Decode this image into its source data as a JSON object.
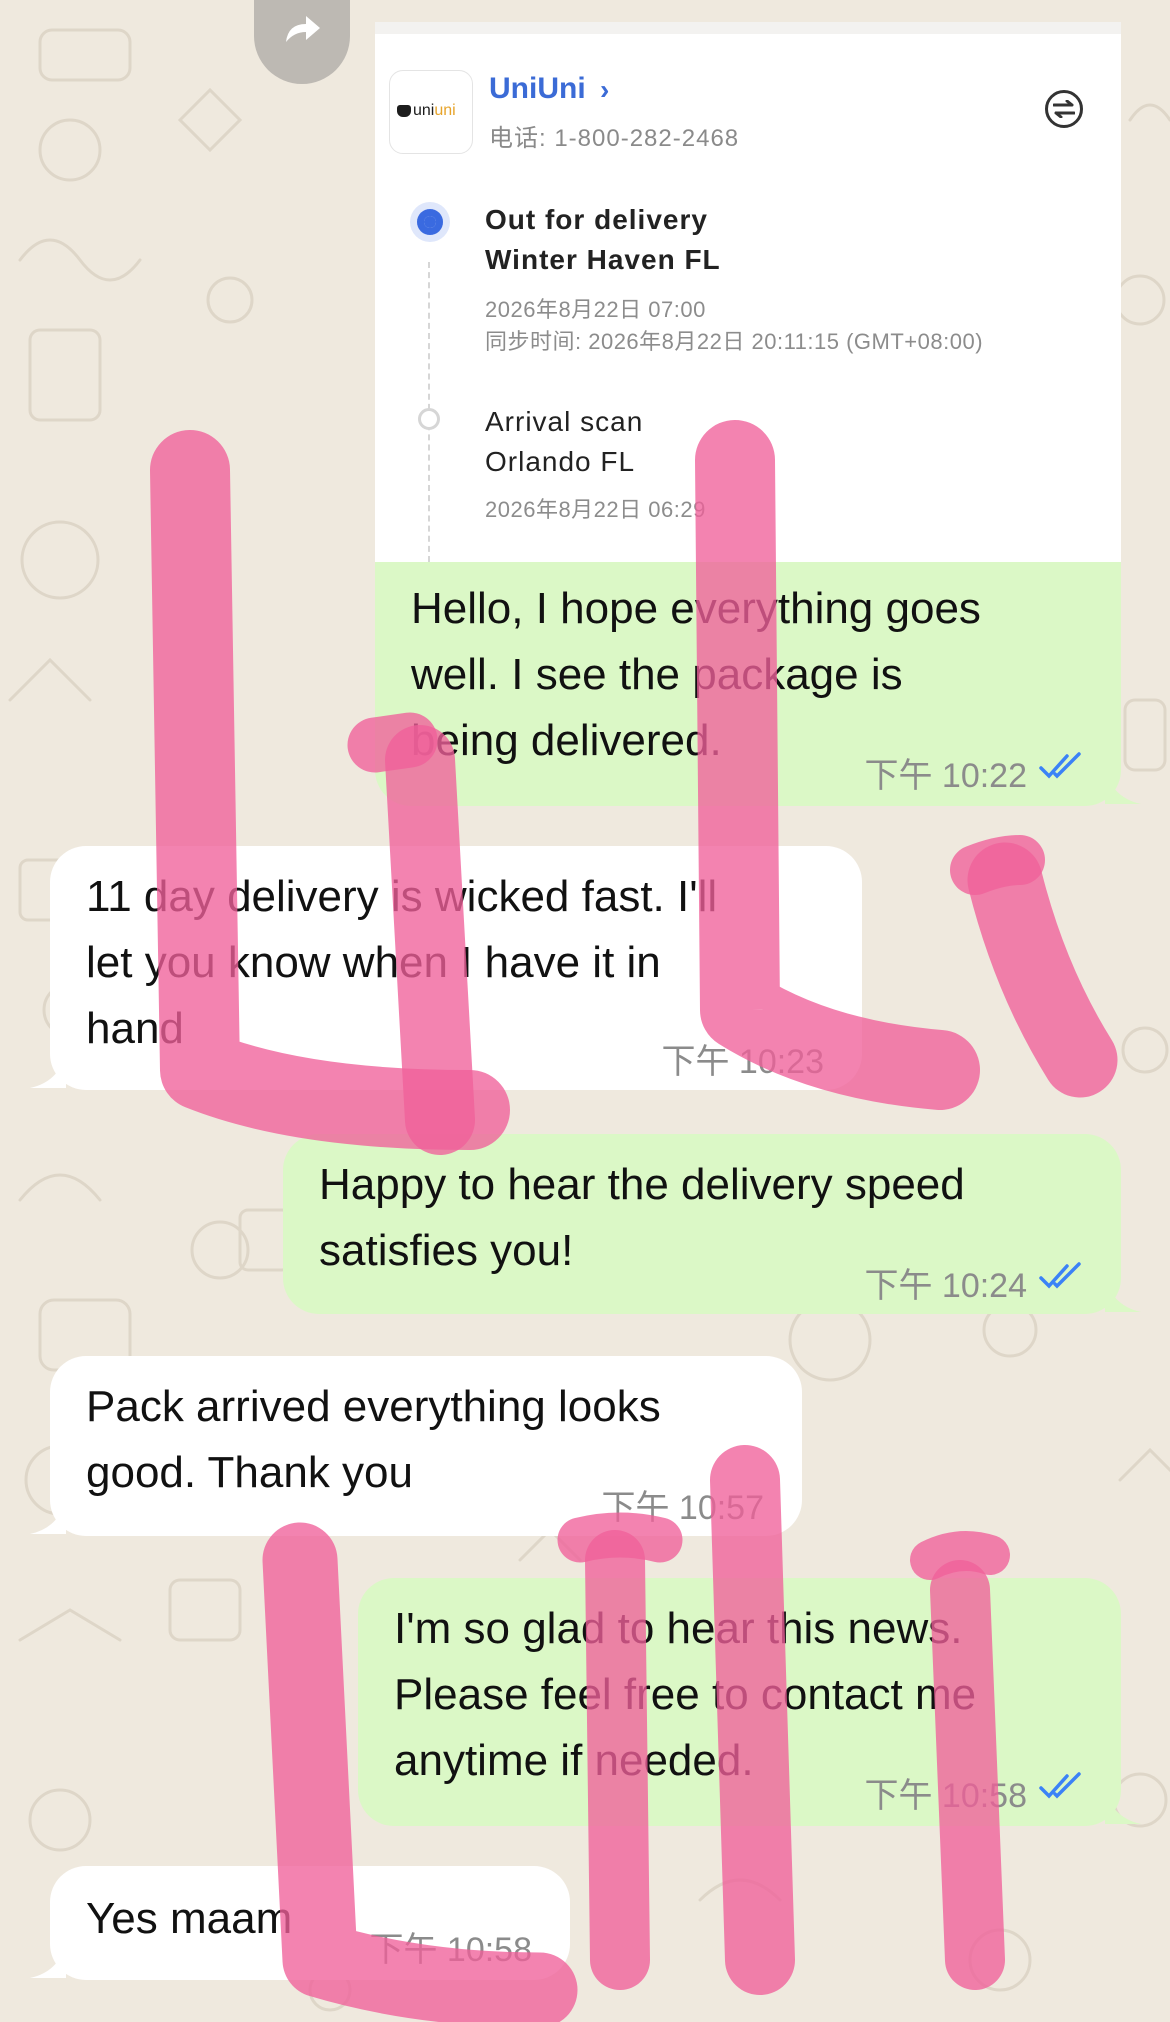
{
  "tracking_card": {
    "carrier_name": "UniUni",
    "carrier_chevron": "›",
    "logo_text_a": "uni",
    "logo_text_b": "uni",
    "phone": "电话: 1-800-282-2468",
    "swap_icon": "swap-arrows-icon",
    "events": [
      {
        "status": "Out for delivery",
        "location": "Winter Haven FL",
        "time": "2026年8月22日 07:00",
        "sync": "同步时间: 2026年8月22日 20:11:15 (GMT+08:00)",
        "active": true
      },
      {
        "status": "Arrival scan",
        "location": "Orlando FL",
        "time": "2026年8月22日 06:29",
        "active": false
      }
    ]
  },
  "messages": [
    {
      "dir": "out",
      "lines": [
        "Hello, I hope everything goes",
        "well. I see the package is",
        "being delivered."
      ],
      "time": "下午 10:22",
      "read": true
    },
    {
      "dir": "in",
      "lines": [
        "11 day delivery is wicked fast. I'll",
        "let you know when I have it in",
        "hand"
      ],
      "time": "下午 10:23"
    },
    {
      "dir": "out",
      "lines": [
        "Happy to hear the delivery speed",
        "satisfies you!"
      ],
      "time": "下午 10:24",
      "read": true
    },
    {
      "dir": "in",
      "lines": [
        "Pack arrived everything looks",
        "good. Thank you"
      ],
      "time": "下午 10:57"
    },
    {
      "dir": "out",
      "lines": [
        "I'm so glad to hear this news.",
        "Please feel free to contact me",
        "anytime if needed."
      ],
      "time": "下午 10:58",
      "read": true
    },
    {
      "dir": "in",
      "lines": [
        "Yes maam"
      ],
      "time": "下午 10:58"
    }
  ],
  "watermark_text": "Lili",
  "colors": {
    "outgoing_bubble": "#dbf8c6",
    "incoming_bubble": "#ffffff",
    "read_tick": "#3b82f6",
    "carrier_blue": "#3b6bd6",
    "watermark_pink": "#f0609a"
  }
}
